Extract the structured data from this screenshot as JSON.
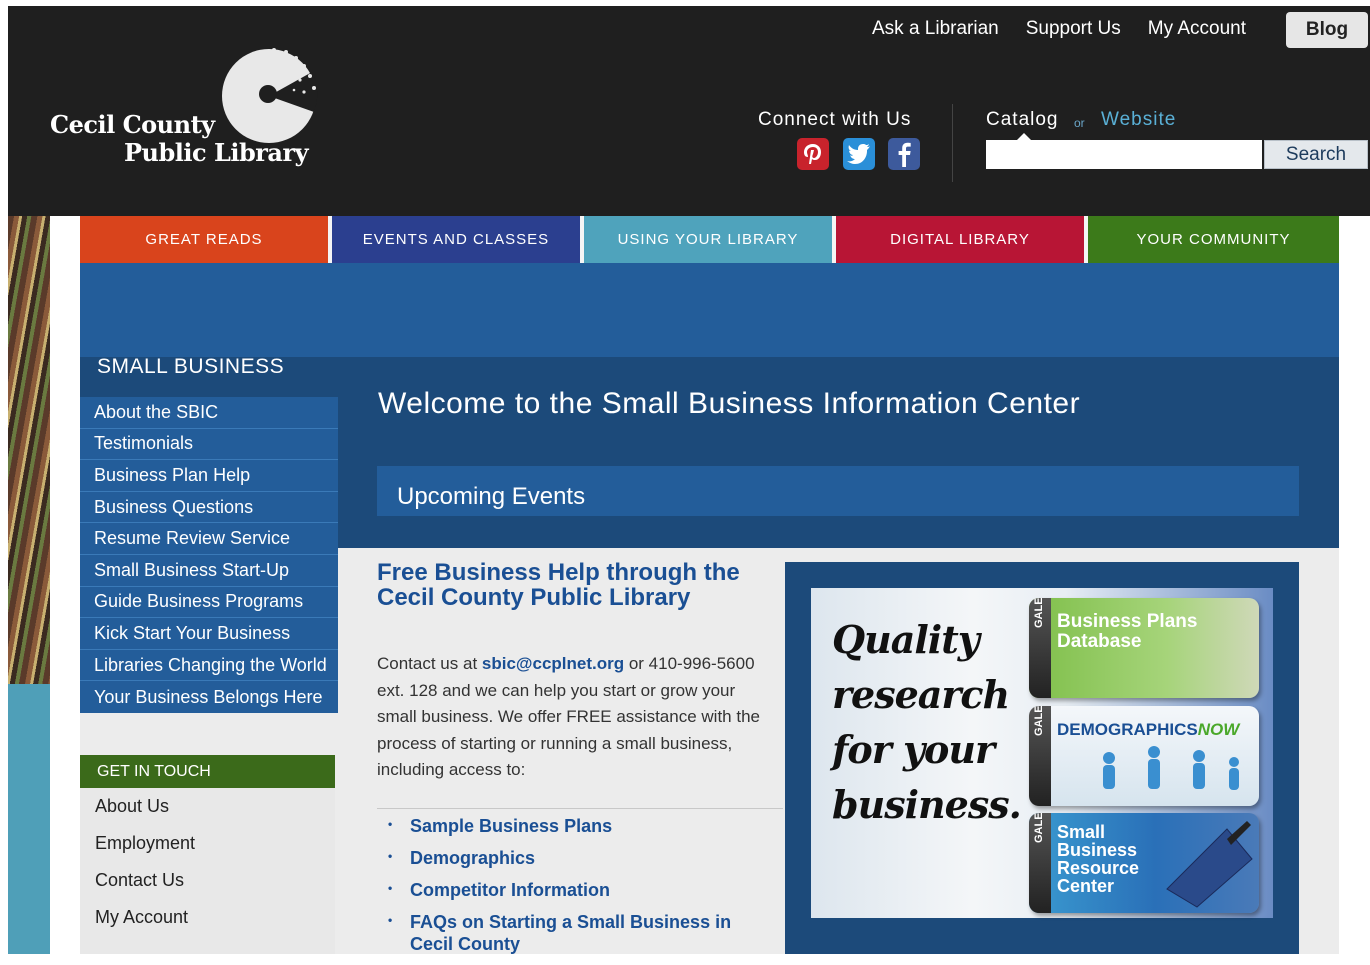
{
  "header": {
    "top_links": [
      "Ask a Librarian",
      "Support Us",
      "My Account"
    ],
    "blog": "Blog",
    "logo_line1": "Cecil County",
    "logo_line2": "Public Library",
    "connect": "Connect with Us",
    "social_icons": [
      "pinterest-icon",
      "twitter-icon",
      "facebook-icon"
    ],
    "catalog": "Catalog",
    "or": "or",
    "website": "Website",
    "search_button": "Search",
    "search_value": ""
  },
  "nav": [
    {
      "label": "GREAT READS",
      "color": "#d9441c"
    },
    {
      "label": "EVENTS AND CLASSES",
      "color": "#2b3f8f"
    },
    {
      "label": "USING YOUR LIBRARY",
      "color": "#4fa3bc"
    },
    {
      "label": "DIGITAL LIBRARY",
      "color": "#b81535"
    },
    {
      "label": "YOUR COMMUNITY",
      "color": "#3c7a1a"
    }
  ],
  "sidebar": {
    "title": "SMALL BUSINESS",
    "items": [
      "About the SBIC",
      "Testimonials",
      "Business Plan Help",
      "Business Questions",
      "Resume Review Service",
      "Small Business Start-Up",
      "Guide Business Programs",
      "Kick Start Your Business",
      "Libraries Changing the World",
      "Your Business Belongs Here"
    ]
  },
  "get_in_touch": {
    "title": "GET IN TOUCH",
    "items": [
      "About Us",
      "Employment",
      "Contact Us",
      "My Account"
    ]
  },
  "main": {
    "welcome": "Welcome to the Small Business Information Center",
    "upcoming": "Upcoming Events",
    "free_title": "Free Business Help through the Cecil County Public Library",
    "contact_prefix": "Contact us at ",
    "email": "sbic@ccplnet.org",
    "contact_rest": " or 410-996-5600 ext. 128 and we can help you start or grow your small business.  We offer FREE assistance with the process of starting or running a small business, including access to:",
    "bullets": [
      "Sample Business Plans",
      "Demographics",
      "Competitor Information",
      "FAQs on Starting a Small Business in Cecil County"
    ]
  },
  "gale": {
    "quality": "Quality research for your business.",
    "gale_label": "GALE",
    "tiles": [
      {
        "title": "Business Plans Database"
      },
      {
        "title_prefix": "DEMOGRAPHICS",
        "title_suffix": "NOW"
      },
      {
        "title": "Small Business Resource Center"
      }
    ]
  },
  "colors": {
    "header_bg": "#1f1f1f",
    "banner_blue": "#235d9a",
    "dark_blue": "#1c4a7a",
    "link_blue": "#1a4f94",
    "green": "#3b6a1a"
  }
}
